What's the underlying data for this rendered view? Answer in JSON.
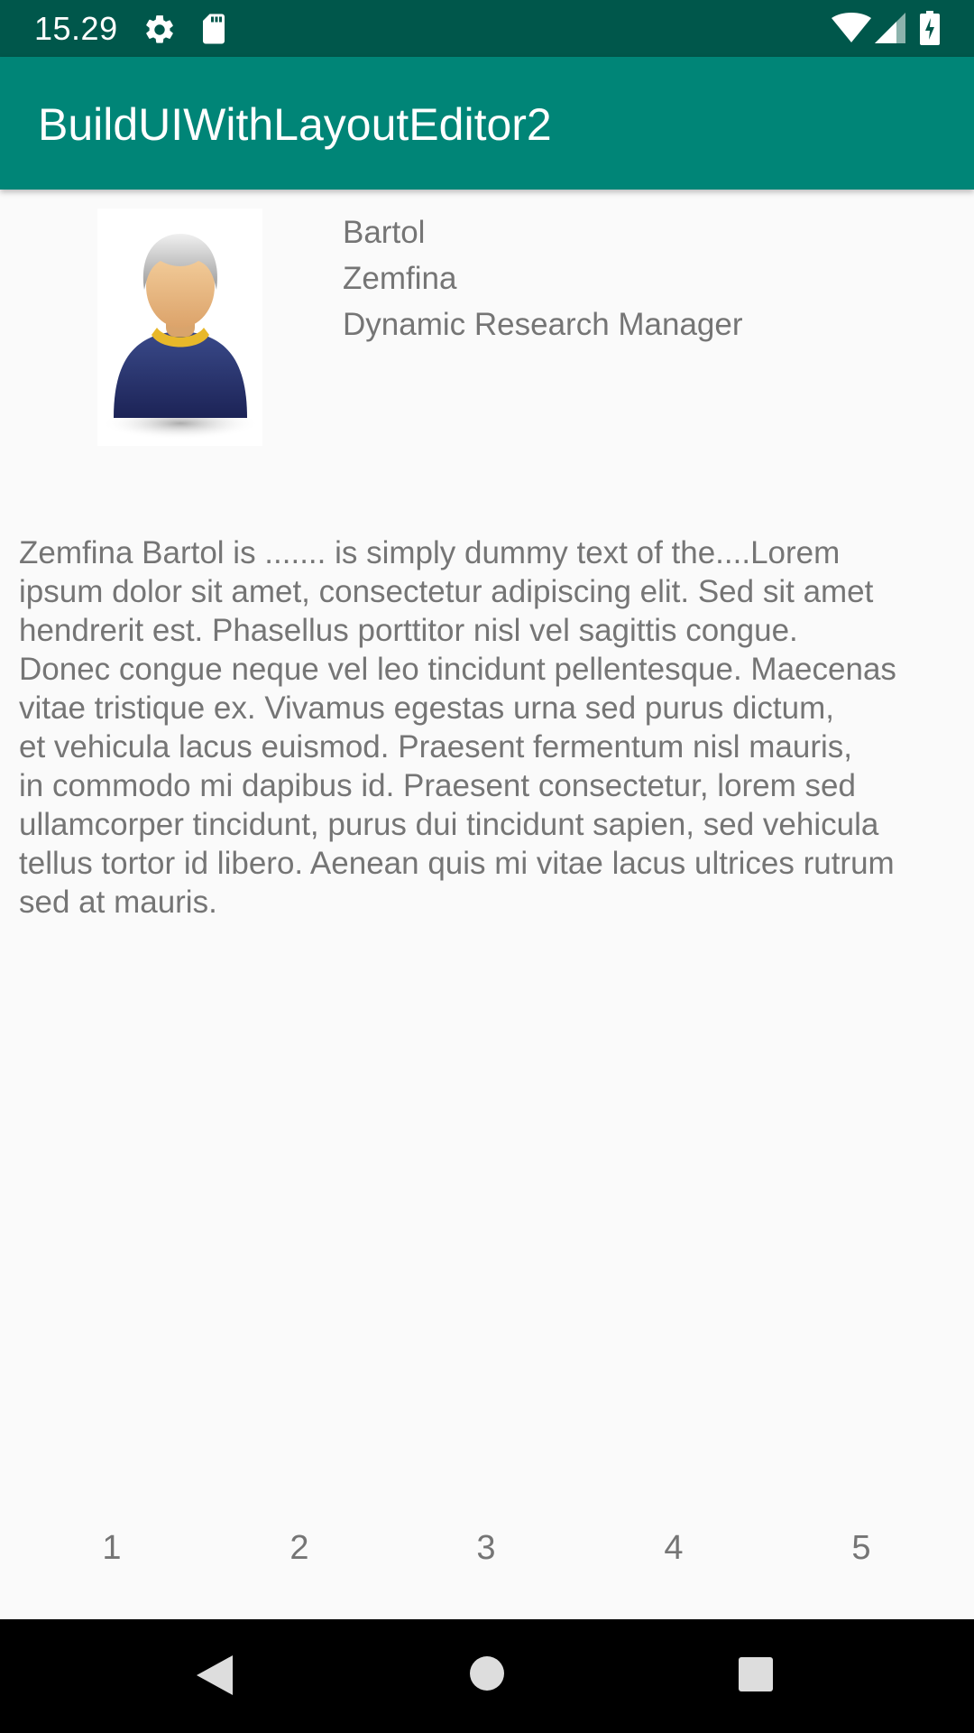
{
  "status_bar": {
    "time": "15.29",
    "icons": [
      "gear-icon",
      "sd-card-icon",
      "wifi-icon",
      "signal-icon",
      "battery-charging-icon"
    ]
  },
  "app_bar": {
    "title": "BuildUIWithLayoutEditor2",
    "color": "#008577"
  },
  "profile": {
    "avatar_icon": "person-avatar-icon",
    "first_name": "Bartol",
    "last_name": "Zemfina",
    "job_title": "Dynamic Research Manager",
    "bio": "Zemfina Bartol is ....... is simply dummy text of the....Lorem\nipsum dolor sit amet, consectetur adipiscing elit. Sed sit amet\nhendrerit est. Phasellus porttitor nisl vel sagittis congue.\nDonec congue neque vel leo tincidunt pellentesque. Maecenas\nvitae tristique ex. Vivamus egestas urna sed purus dictum,\net vehicula lacus euismod. Praesent fermentum nisl mauris,\nin commodo mi dapibus id. Praesent consectetur, lorem sed\nullamcorper tincidunt, purus dui tincidunt sapien, sed vehicula\ntellus tortor id libero. Aenean quis mi vitae lacus ultrices rutrum\nsed at mauris."
  },
  "numbers": [
    "1",
    "2",
    "3",
    "4",
    "5"
  ],
  "nav_bar": {
    "icons": [
      "back-icon",
      "home-icon",
      "recent-apps-icon"
    ]
  }
}
